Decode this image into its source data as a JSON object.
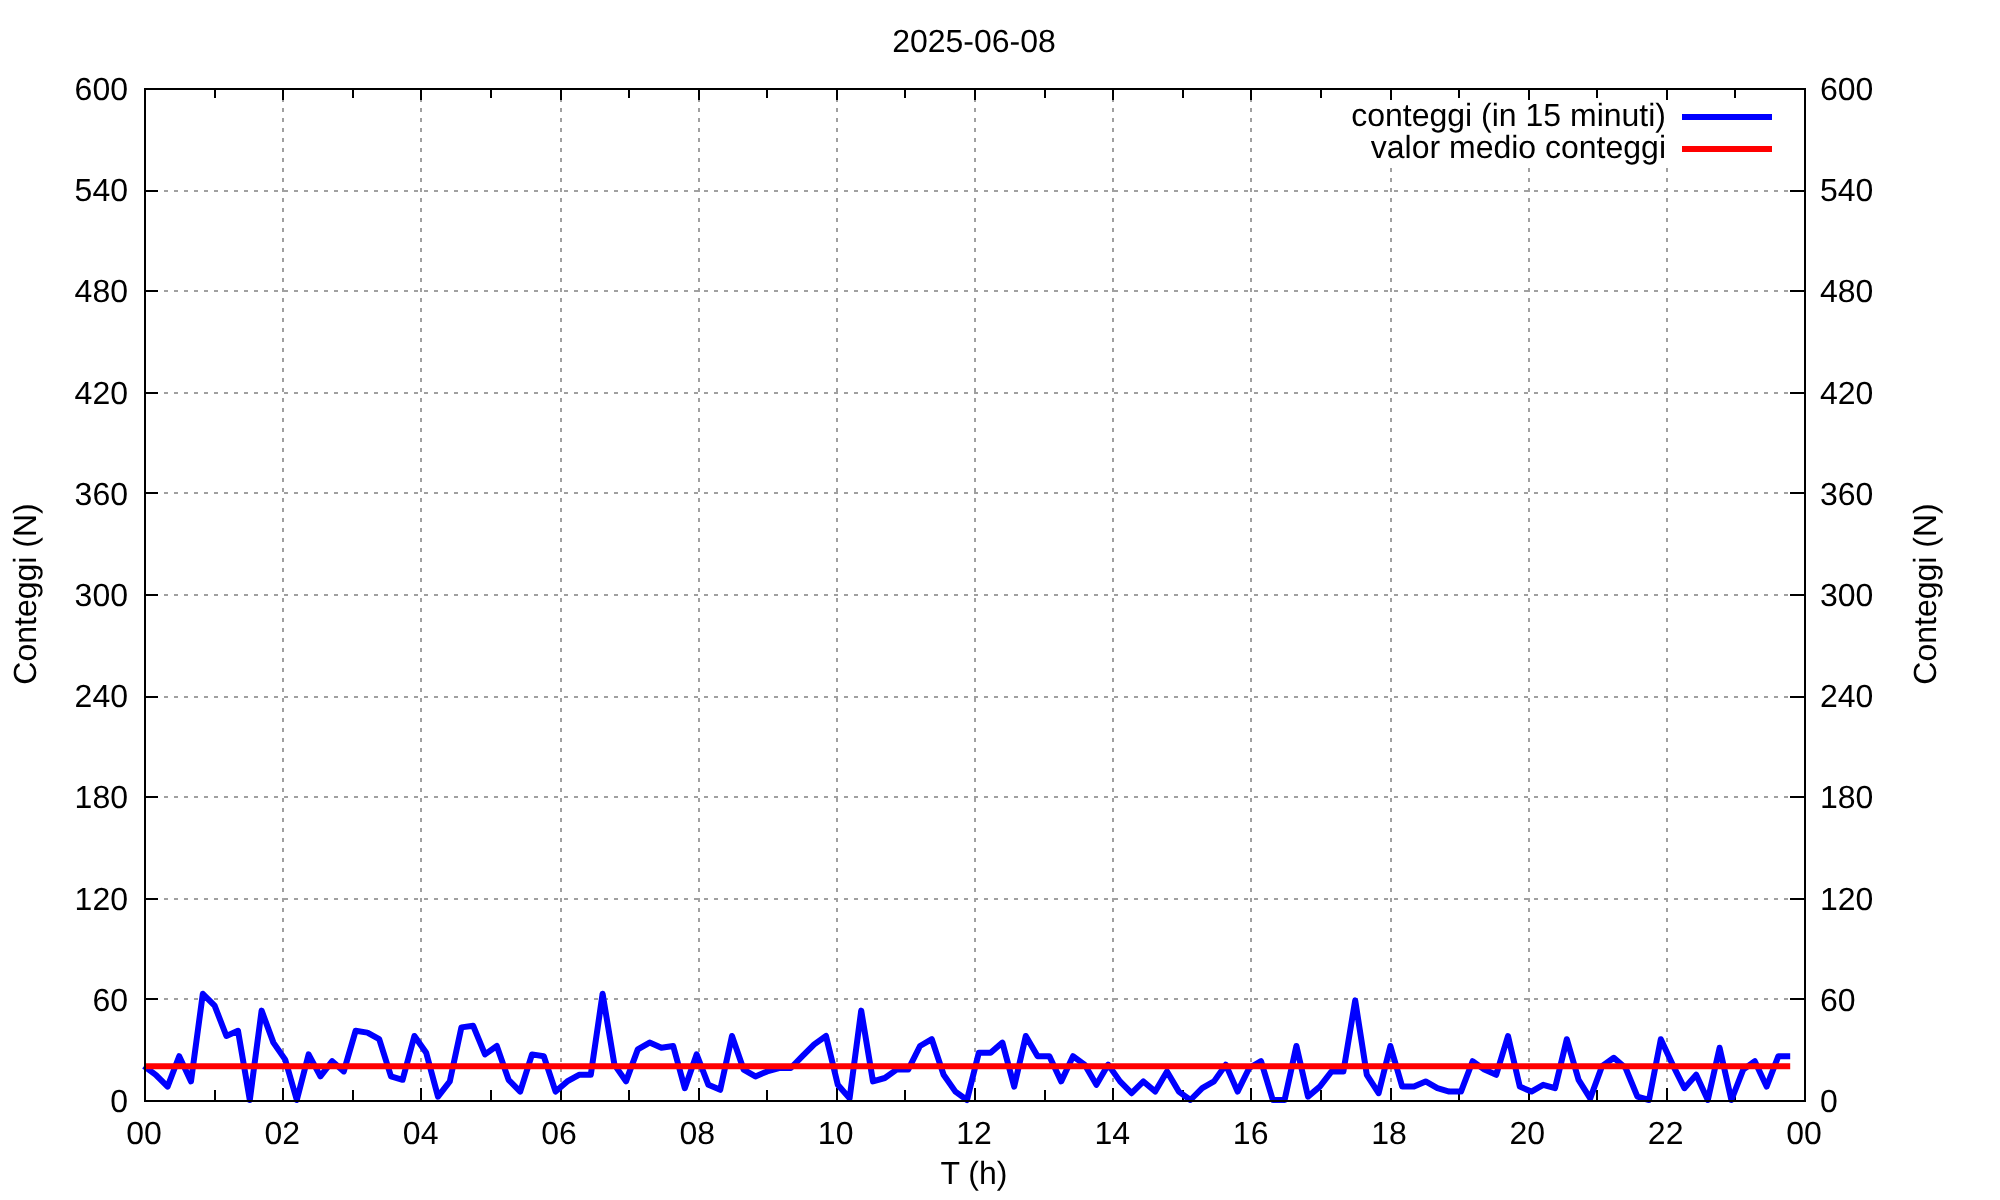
{
  "chart": {
    "chart_data": {
      "type": "line",
      "title": "2025-06-08",
      "xlabel": "T (h)",
      "ylabel": "Conteggi (N)",
      "y2label": "Conteggi (N)",
      "grid": true,
      "legend": "upper right",
      "x": [
        0,
        0.17,
        0.34,
        0.51,
        0.68,
        0.85,
        1.02,
        1.19,
        1.36,
        1.53,
        1.7,
        1.87,
        2.04,
        2.21,
        2.38,
        2.55,
        2.72,
        2.89,
        3.06,
        3.23,
        3.4,
        3.57,
        3.74,
        3.91,
        4.08,
        4.25,
        4.42,
        4.59,
        4.76,
        4.93,
        5.1,
        5.27,
        5.44,
        5.61,
        5.78,
        5.95,
        6.12,
        6.29,
        6.46,
        6.63,
        6.8,
        6.97,
        7.14,
        7.31,
        7.48,
        7.65,
        7.82,
        7.99,
        8.16,
        8.33,
        8.5,
        8.67,
        8.84,
        9.01,
        9.18,
        9.35,
        9.52,
        9.69,
        9.86,
        10.03,
        10.2,
        10.37,
        10.54,
        10.71,
        10.88,
        11.05,
        11.22,
        11.39,
        11.56,
        11.73,
        11.9,
        12.07,
        12.24,
        12.41,
        12.58,
        12.75,
        12.92,
        13.09,
        13.26,
        13.43,
        13.6,
        13.77,
        13.94,
        14.11,
        14.28,
        14.45,
        14.62,
        14.79,
        14.96,
        15.13,
        15.3,
        15.47,
        15.64,
        15.81,
        15.98,
        16.15,
        16.32,
        16.49,
        16.66,
        16.83,
        17,
        17.17,
        17.34,
        17.51,
        17.68,
        17.85,
        18.02,
        18.19,
        18.36,
        18.53,
        18.7,
        18.87,
        19.04,
        19.21,
        19.38,
        19.55,
        19.72,
        19.89,
        20.06,
        20.23,
        20.4,
        20.57,
        20.74,
        20.91,
        21.08,
        21.25,
        21.42,
        21.59,
        21.76,
        21.93,
        22.1,
        22.27,
        22.44,
        22.61,
        22.78,
        22.95,
        23.12,
        23.29,
        23.46,
        23.63,
        23.8
      ],
      "series": [
        {
          "name": "conteggi (in 15 minuti)",
          "color": "#0000ff",
          "values": [
            20,
            15,
            8,
            26,
            11,
            63,
            56,
            38,
            41,
            0,
            53,
            34,
            24,
            0,
            27,
            14,
            23,
            17,
            41,
            40,
            36,
            14,
            12,
            38,
            28,
            2,
            11,
            43,
            44,
            27,
            32,
            12,
            5,
            27,
            26,
            5,
            11,
            15,
            15,
            63,
            21,
            11,
            30,
            34,
            31,
            32,
            7,
            27,
            9,
            6,
            38,
            18,
            14,
            17,
            19,
            19,
            26,
            33,
            38,
            9,
            1,
            53,
            11,
            13,
            18,
            18,
            32,
            36,
            15,
            5,
            0,
            28,
            28,
            34,
            8,
            38,
            26,
            26,
            11,
            26,
            21,
            9,
            21,
            11,
            4,
            11,
            5,
            17,
            5,
            0,
            7,
            11,
            21,
            5,
            19,
            23,
            0,
            0,
            32,
            2,
            8,
            17,
            17,
            59,
            15,
            4,
            32,
            8,
            8,
            11,
            7,
            5,
            5,
            23,
            18,
            15,
            38,
            8,
            5,
            9,
            7,
            36,
            12,
            1,
            20,
            25,
            19,
            2,
            0,
            36,
            21,
            7,
            15,
            0,
            31,
            0,
            18,
            23,
            8,
            26,
            26
          ]
        },
        {
          "name": "valor medio conteggi",
          "color": "#ff0000",
          "values": [
            20,
            20,
            20,
            20,
            20,
            20,
            20,
            20,
            20,
            20,
            20,
            20,
            20,
            20,
            20,
            20,
            20,
            20,
            20,
            20,
            20,
            20,
            20,
            20,
            20,
            20,
            20,
            20,
            20,
            20,
            20,
            20,
            20,
            20,
            20,
            20,
            20,
            20,
            20,
            20,
            20,
            20,
            20,
            20,
            20,
            20,
            20,
            20,
            20,
            20,
            20,
            20,
            20,
            20,
            20,
            20,
            20,
            20,
            20,
            20,
            20,
            20,
            20,
            20,
            20,
            20,
            20,
            20,
            20,
            20,
            20,
            20,
            20,
            20,
            20,
            20,
            20,
            20,
            20,
            20,
            20,
            20,
            20,
            20,
            20,
            20,
            20,
            20,
            20,
            20,
            20,
            20,
            20,
            20,
            20,
            20,
            20,
            20,
            20,
            20,
            20,
            20,
            20,
            20,
            20,
            20,
            20,
            20,
            20,
            20,
            20,
            20,
            20,
            20,
            20,
            20,
            20,
            20,
            20,
            20,
            20,
            20,
            20,
            20,
            20,
            20,
            20,
            20,
            20,
            20,
            20,
            20,
            20,
            20,
            20,
            20,
            20,
            20,
            20,
            20,
            20
          ]
        }
      ],
      "xlim": [
        0,
        24
      ],
      "ylim": [
        0,
        600
      ],
      "y2lim": [
        0,
        600
      ],
      "xticks": [
        {
          "value": 0,
          "label": "00"
        },
        {
          "value": 2,
          "label": "02"
        },
        {
          "value": 4,
          "label": "04"
        },
        {
          "value": 6,
          "label": "06"
        },
        {
          "value": 8,
          "label": "08"
        },
        {
          "value": 10,
          "label": "10"
        },
        {
          "value": 12,
          "label": "12"
        },
        {
          "value": 14,
          "label": "14"
        },
        {
          "value": 16,
          "label": "16"
        },
        {
          "value": 18,
          "label": "18"
        },
        {
          "value": 20,
          "label": "20"
        },
        {
          "value": 22,
          "label": "22"
        },
        {
          "value": 24,
          "label": "00"
        }
      ],
      "yticks": [
        {
          "value": 600,
          "label": "600"
        },
        {
          "value": 540,
          "label": "540"
        },
        {
          "value": 480,
          "label": "480"
        },
        {
          "value": 420,
          "label": "420"
        },
        {
          "value": 360,
          "label": "360"
        },
        {
          "value": 300,
          "label": "300"
        },
        {
          "value": 240,
          "label": "240"
        },
        {
          "value": 180,
          "label": "180"
        },
        {
          "value": 120,
          "label": "120"
        },
        {
          "value": 60,
          "label": "60"
        },
        {
          "value": 0,
          "label": "0"
        }
      ],
      "y2ticks": [
        {
          "value": 600,
          "label": "600"
        },
        {
          "value": 540,
          "label": "540"
        },
        {
          "value": 480,
          "label": "480"
        },
        {
          "value": 420,
          "label": "420"
        },
        {
          "value": 360,
          "label": "360"
        },
        {
          "value": 300,
          "label": "300"
        },
        {
          "value": 240,
          "label": "240"
        },
        {
          "value": 180,
          "label": "180"
        },
        {
          "value": 120,
          "label": "120"
        },
        {
          "value": 60,
          "label": "60"
        },
        {
          "value": 0,
          "label": "0"
        }
      ]
    }
  }
}
